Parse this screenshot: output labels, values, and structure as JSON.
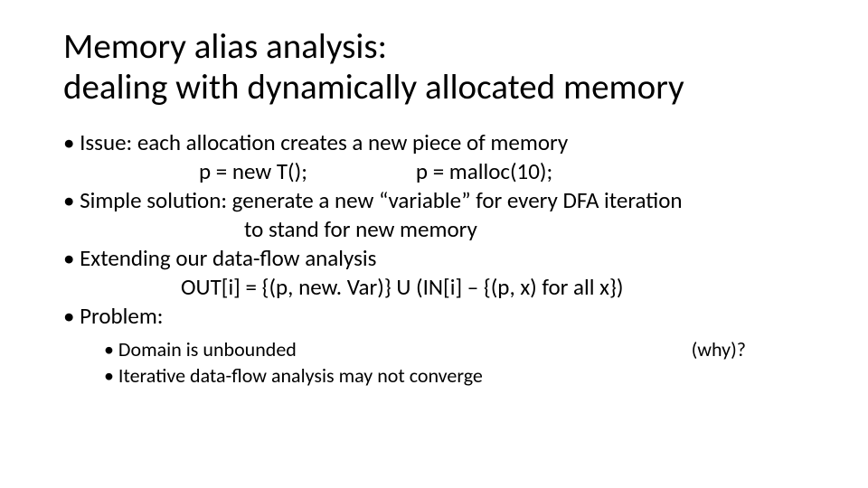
{
  "title_line1": "Memory alias analysis:",
  "title_line2": "dealing with dynamically allocated memory",
  "bullets": {
    "b1": "• Issue: each allocation creates a new piece of memory",
    "code_a": "p = new T();",
    "code_b": "p = malloc(10);",
    "b2": "• Simple solution: generate a new “variable” for every DFA iteration",
    "b2_cont": "to stand for new memory",
    "b3": "• Extending our data-flow analysis",
    "formula": "OUT[i] = {(p, new. Var)} U (IN[i] – {(p, x) for all x})",
    "b4": "• Problem:",
    "sub1": "• Domain is unbounded",
    "sub1_aside": "(why)?",
    "sub2": "• Iterative data-flow analysis may not converge"
  }
}
